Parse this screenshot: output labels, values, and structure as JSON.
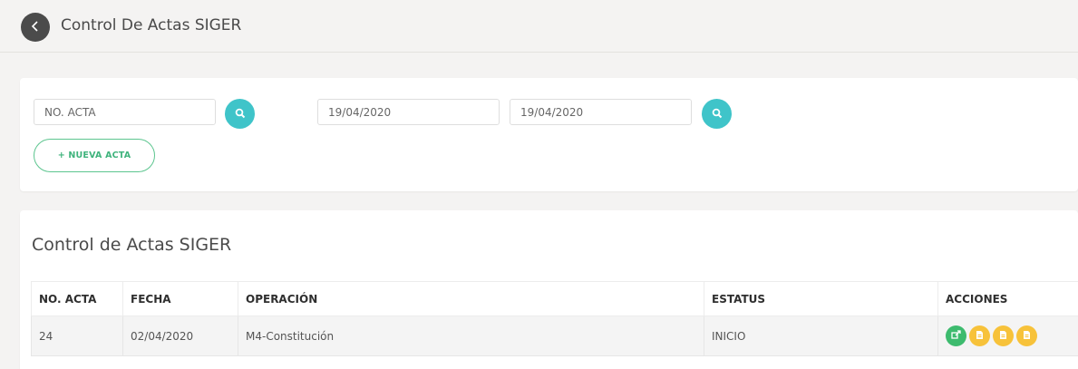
{
  "header": {
    "title": "Control De Actas SIGER",
    "back_icon": "chevron-left-icon"
  },
  "filters": {
    "acta_placeholder": "NO. ACTA",
    "acta_value": "",
    "date_from": "19/04/2020",
    "date_to": "19/04/2020",
    "new_button_label": "+ NUEVA ACTA",
    "search_color": "#3fc4c9"
  },
  "results": {
    "title": "Control de Actas SIGER",
    "columns": [
      "NO. ACTA",
      "FECHA",
      "OPERACIÓN",
      "ESTATUS",
      "ACCIONES"
    ],
    "rows": [
      {
        "no_acta": "24",
        "fecha": "02/04/2020",
        "operacion": "M4-Constitución",
        "estatus": "INICIO"
      }
    ],
    "action_colors": {
      "edit": "#3dbb6e",
      "document": "#f7c23a"
    }
  }
}
